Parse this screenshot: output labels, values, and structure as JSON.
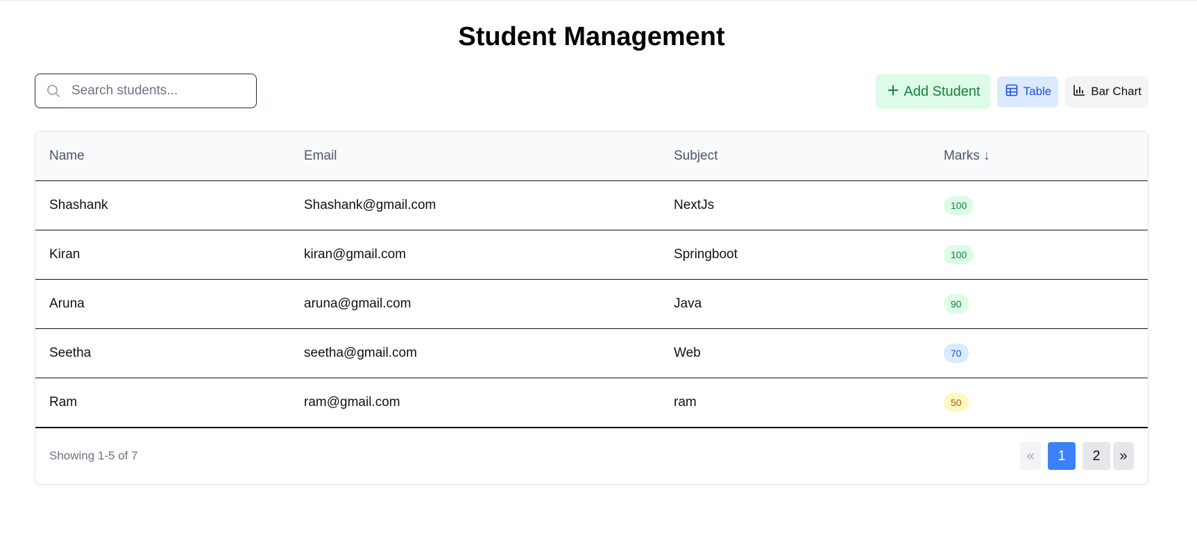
{
  "page": {
    "title": "Student Management"
  },
  "search": {
    "placeholder": "Search students...",
    "value": "",
    "icon": "search-icon"
  },
  "toolbar": {
    "add_label": "Add Student",
    "add_icon": "plus-icon",
    "table_label": "Table",
    "table_icon": "table-icon",
    "chart_label": "Bar Chart",
    "chart_icon": "bar-chart-icon",
    "active_view": "Table"
  },
  "table": {
    "columns": [
      "Name",
      "Email",
      "Subject",
      "Marks ↓"
    ],
    "rows": [
      {
        "name": "Shashank",
        "email": "Shashank@gmail.com",
        "subject": "NextJs",
        "marks": "100",
        "badge": "green"
      },
      {
        "name": "Kiran",
        "email": "kiran@gmail.com",
        "subject": "Springboot",
        "marks": "100",
        "badge": "green"
      },
      {
        "name": "Aruna",
        "email": "aruna@gmail.com",
        "subject": "Java",
        "marks": "90",
        "badge": "green"
      },
      {
        "name": "Seetha",
        "email": "seetha@gmail.com",
        "subject": "Web",
        "marks": "70",
        "badge": "blue"
      },
      {
        "name": "Ram",
        "email": "ram@gmail.com",
        "subject": "ram",
        "marks": "50",
        "badge": "yellow"
      }
    ]
  },
  "footer": {
    "showing": "Showing 1-5 of 7",
    "pagination": {
      "prev": "«",
      "pages": [
        "1",
        "2"
      ],
      "current": "1",
      "next": "»"
    }
  },
  "colors": {
    "accent_blue": "#3b82f6",
    "add_green_bg": "#dcfce7",
    "add_green_text": "#15803d",
    "table_active_bg": "#dbeafe",
    "table_active_text": "#1d4ed8",
    "badge_yellow_bg": "#fef9c3"
  }
}
